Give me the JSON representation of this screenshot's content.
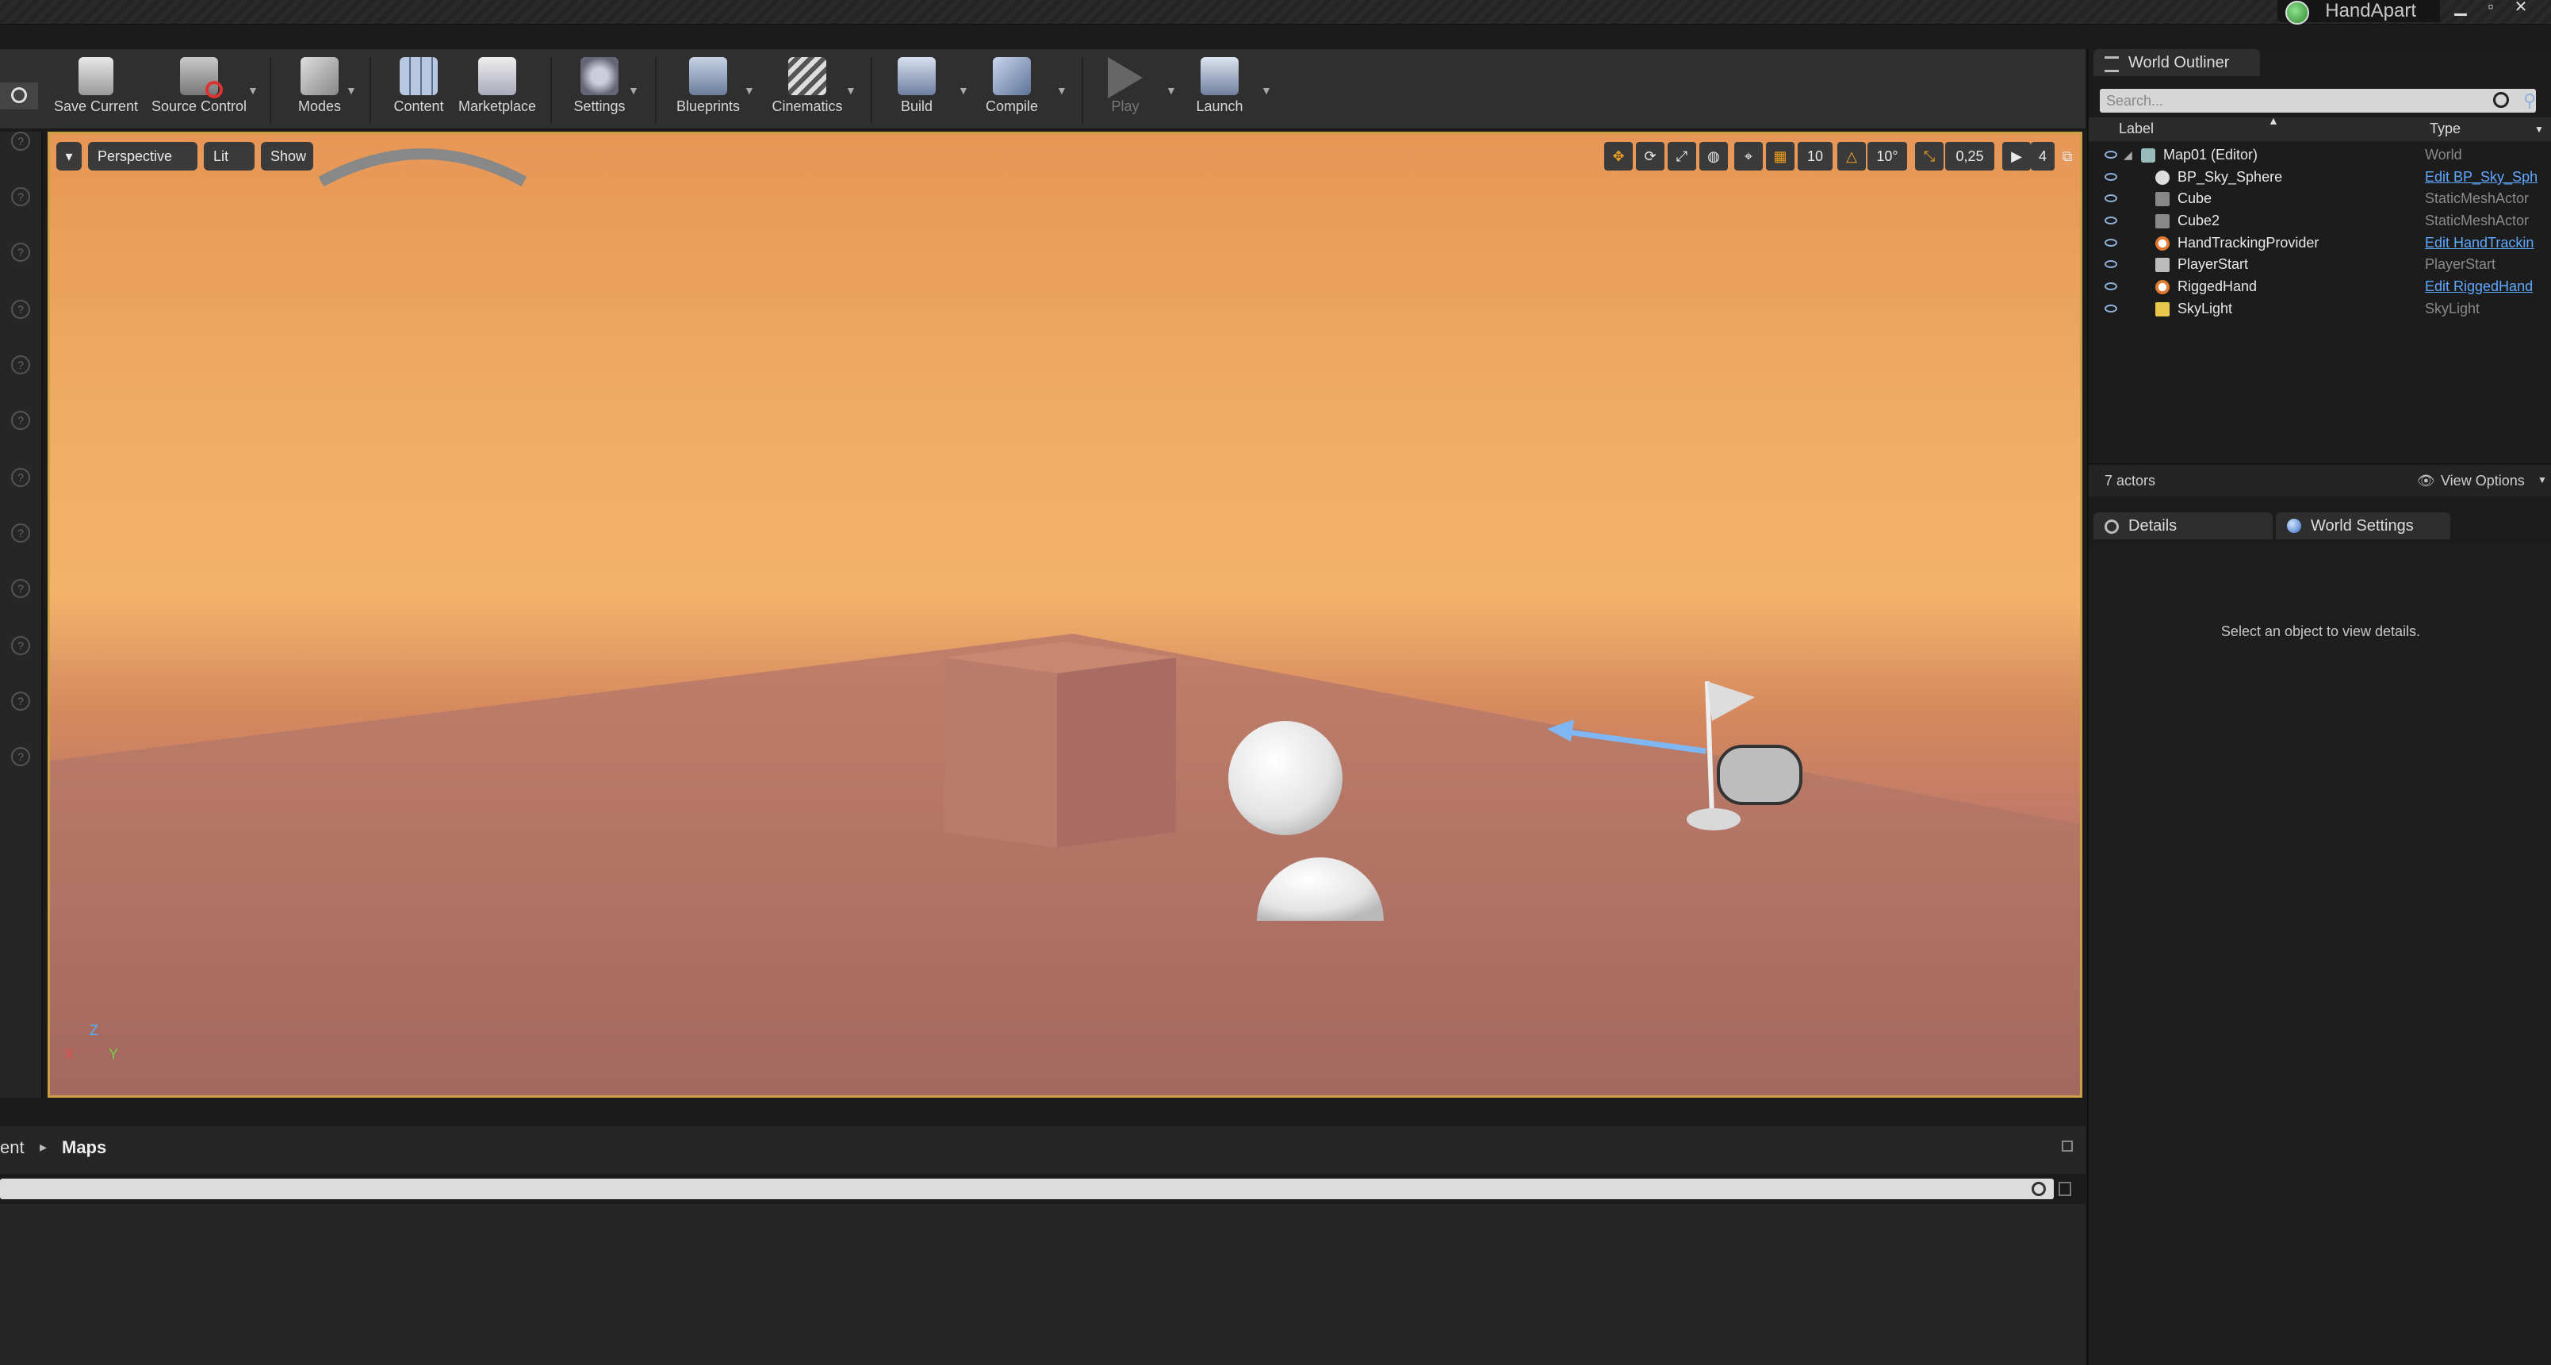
{
  "window": {
    "project_name": "HandApart"
  },
  "toolbar": {
    "buttons": [
      {
        "label": "Save Current",
        "icon": "save-icon"
      },
      {
        "label": "Source Control",
        "icon": "source-control-icon"
      },
      {
        "label": "Modes",
        "icon": "modes-icon"
      },
      {
        "label": "Content",
        "icon": "content-icon"
      },
      {
        "label": "Marketplace",
        "icon": "marketplace-icon"
      },
      {
        "label": "Settings",
        "icon": "settings-icon"
      },
      {
        "label": "Blueprints",
        "icon": "blueprints-icon"
      },
      {
        "label": "Cinematics",
        "icon": "cinematics-icon"
      },
      {
        "label": "Build",
        "icon": "build-icon"
      },
      {
        "label": "Compile",
        "icon": "compile-icon"
      },
      {
        "label": "Play",
        "icon": "play-icon"
      },
      {
        "label": "Launch",
        "icon": "launch-icon"
      }
    ]
  },
  "viewport": {
    "view_mode": "Perspective",
    "lighting": "Lit",
    "show": "Show",
    "grid_snap": "10",
    "rotation_snap": "10°",
    "scale_snap": "0,25",
    "camera_speed": "4",
    "axis_labels": {
      "z": "Z",
      "y": "Y",
      "x": "X"
    }
  },
  "content_browser": {
    "path_prev": "ent",
    "path_current": "Maps"
  },
  "world_outliner": {
    "tab_label": "World Outliner",
    "search_placeholder": "Search...",
    "col_label": "Label",
    "col_type": "Type",
    "rows": [
      {
        "label": "Map01 (Editor)",
        "type": "World",
        "link": false,
        "icon": "world-icon"
      },
      {
        "label": "BP_Sky_Sphere",
        "type": "Edit BP_Sky_Sph",
        "link": true,
        "icon": "sphere-icon"
      },
      {
        "label": "Cube",
        "type": "StaticMeshActor",
        "link": false,
        "icon": "static-mesh-icon"
      },
      {
        "label": "Cube2",
        "type": "StaticMeshActor",
        "link": false,
        "icon": "static-mesh-icon"
      },
      {
        "label": "HandTrackingProvider",
        "type": "Edit HandTrackin",
        "link": true,
        "icon": "actor-icon"
      },
      {
        "label": "PlayerStart",
        "type": "PlayerStart",
        "link": false,
        "icon": "player-start-icon"
      },
      {
        "label": "RiggedHand",
        "type": "Edit RiggedHand",
        "link": true,
        "icon": "actor-icon"
      },
      {
        "label": "SkyLight",
        "type": "SkyLight",
        "link": false,
        "icon": "skylight-icon"
      }
    ],
    "actor_count": "7 actors",
    "view_options": "View Options"
  },
  "details": {
    "tab_details": "Details",
    "tab_world_settings": "World Settings",
    "empty_message": "Select an object to view details."
  },
  "colors": {
    "accent_border": "#c9a044",
    "link": "#5fa8ff",
    "sky_top": "#e79656",
    "floor": "#b9756a"
  }
}
